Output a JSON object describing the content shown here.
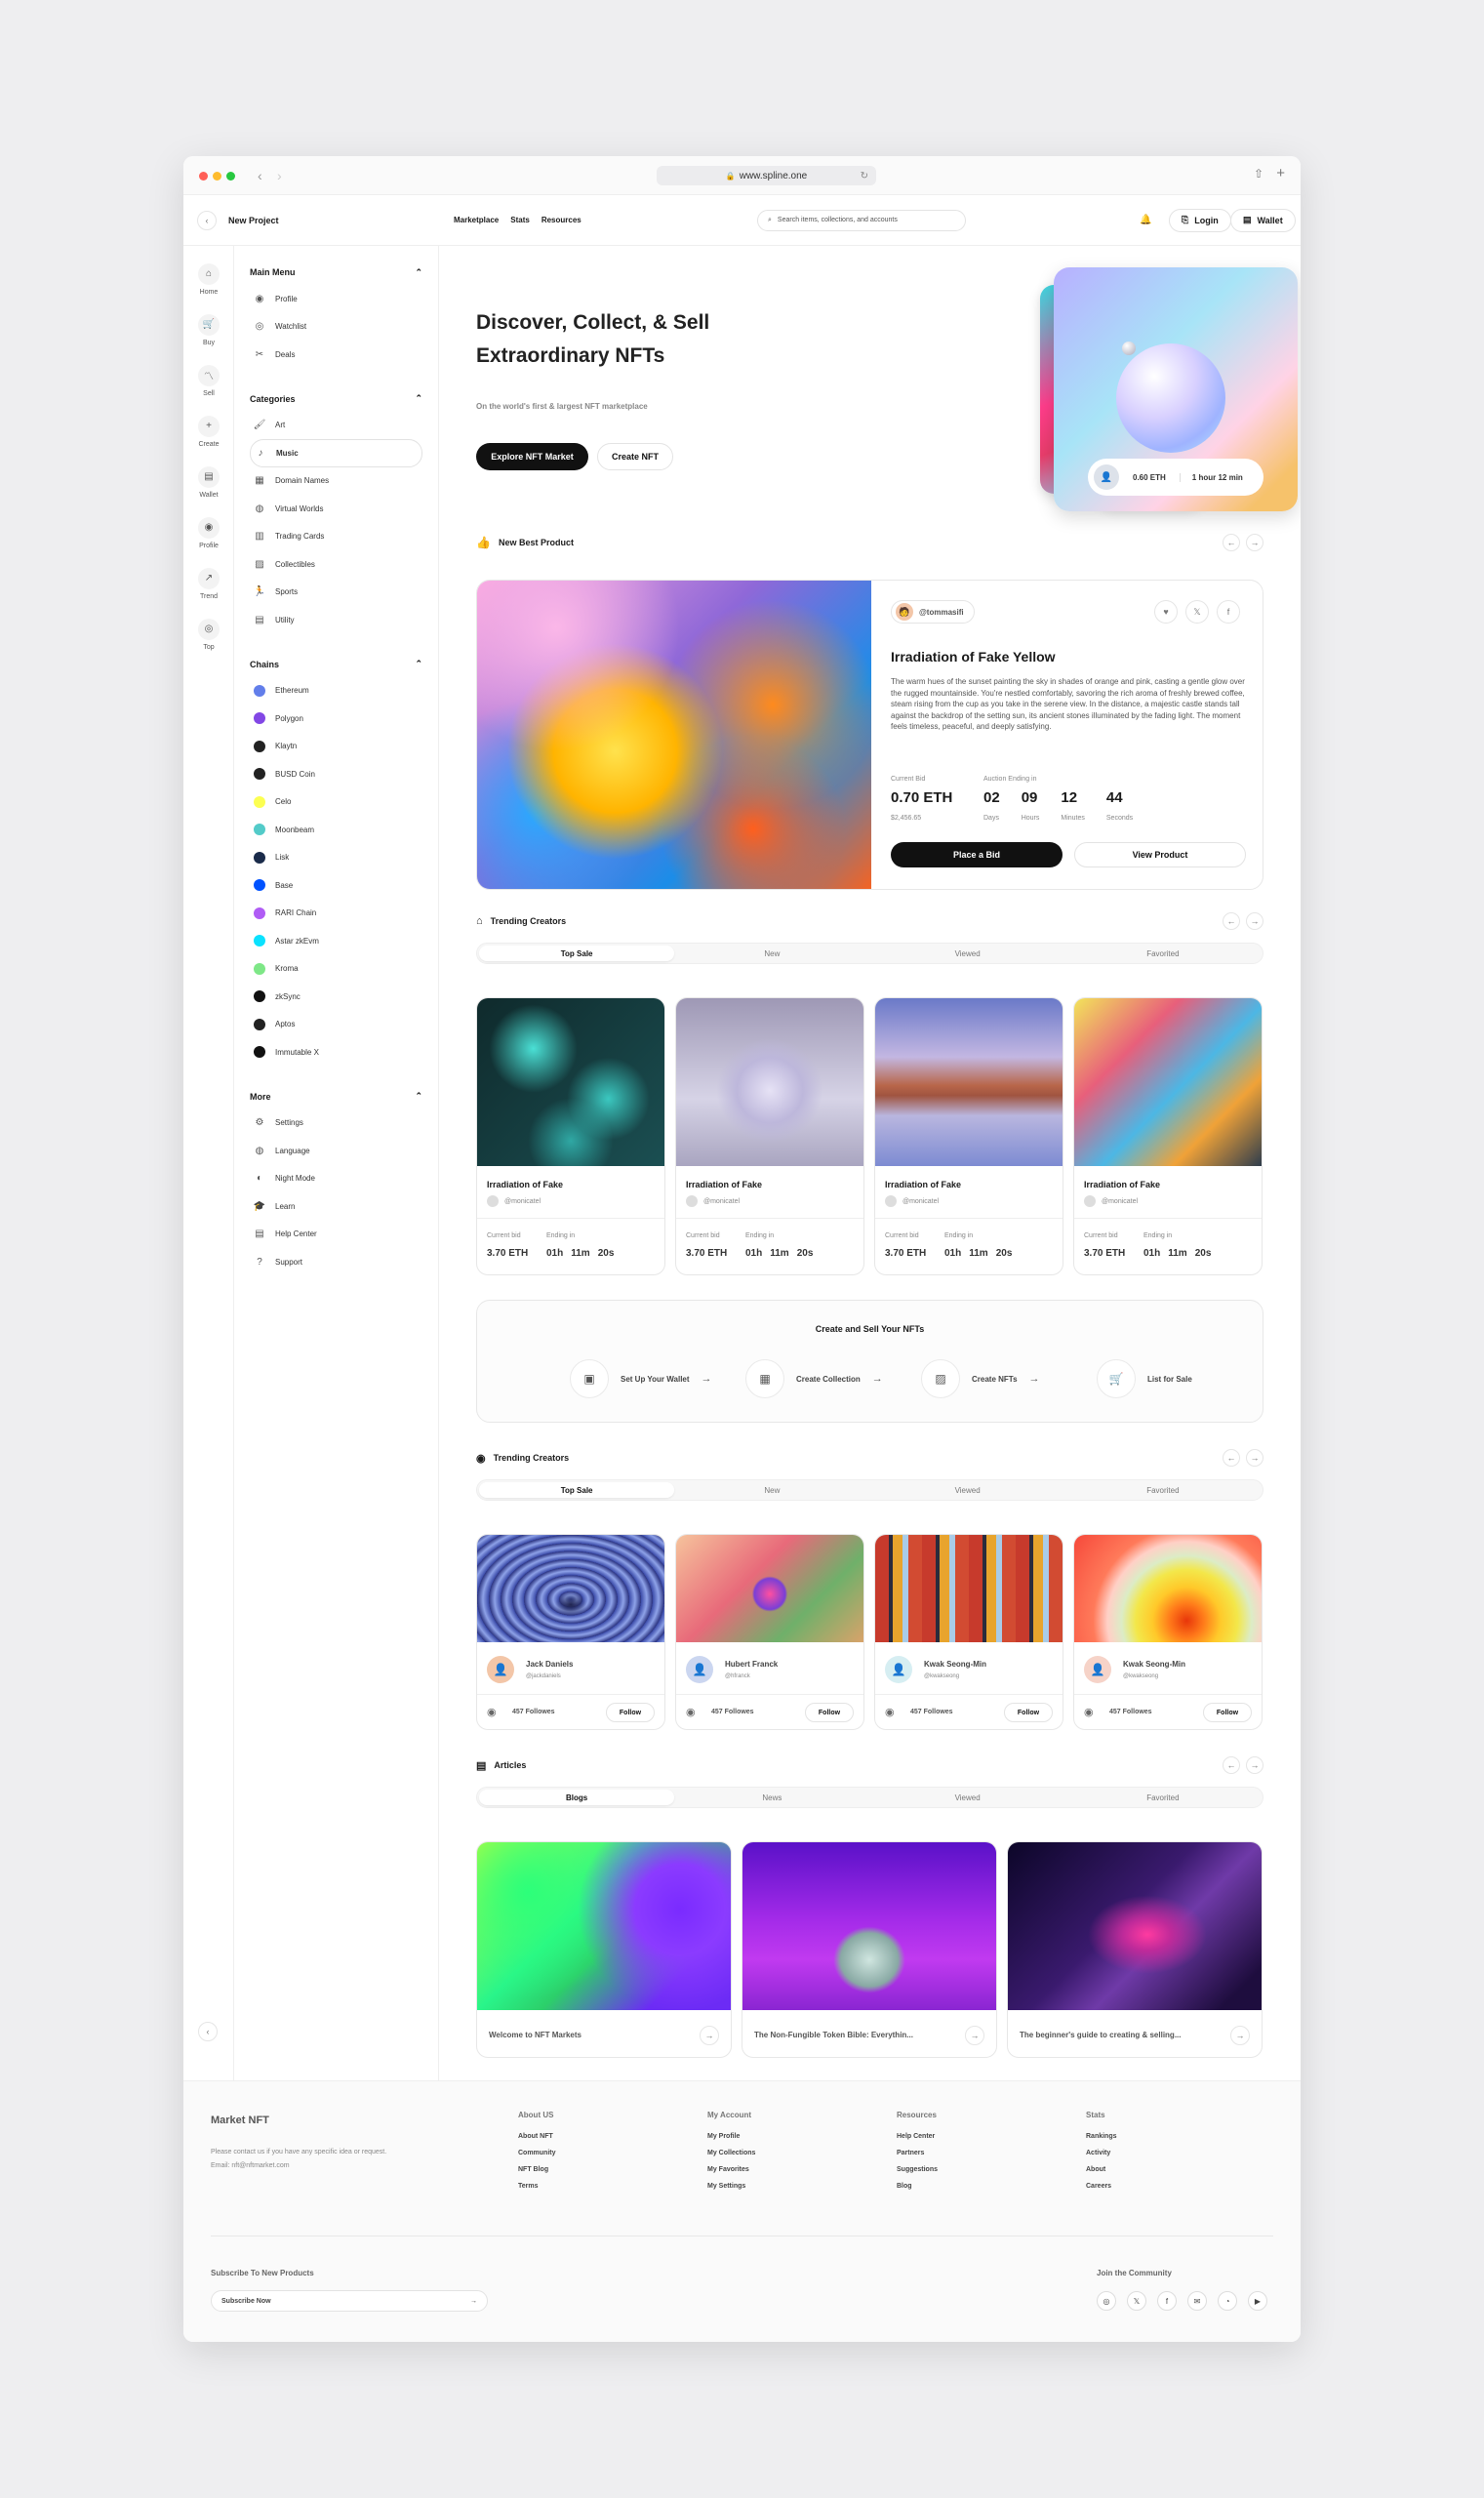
{
  "browser": {
    "url": "www.spline.one"
  },
  "appbar": {
    "project": "New Project",
    "nav": [
      "Marketplace",
      "Stats",
      "Resources"
    ],
    "search_placeholder": "Search items, collections, and accounts",
    "login": "Login",
    "wallet": "Wallet"
  },
  "rail": [
    {
      "label": "Home",
      "icon": "home-icon"
    },
    {
      "label": "Buy",
      "icon": "cart-icon"
    },
    {
      "label": "Sell",
      "icon": "chart-icon"
    },
    {
      "label": "Create",
      "icon": "plus-icon"
    },
    {
      "label": "Wallet",
      "icon": "wallet-icon"
    },
    {
      "label": "Profile",
      "icon": "user-icon"
    },
    {
      "label": "Trend",
      "icon": "trend-icon"
    },
    {
      "label": "Top",
      "icon": "top-icon"
    }
  ],
  "sidebar": {
    "main_menu": {
      "title": "Main Menu",
      "items": [
        "Profile",
        "Watchlist",
        "Deals"
      ]
    },
    "categories": {
      "title": "Categories",
      "items": [
        "Art",
        "Music",
        "Domain Names",
        "Virtual Worlds",
        "Trading Cards",
        "Collectibles",
        "Sports",
        "Utility"
      ],
      "active": "Music"
    },
    "chains": {
      "title": "Chains",
      "items": [
        {
          "name": "Ethereum",
          "color": "#627eea"
        },
        {
          "name": "Polygon",
          "color": "#8247e5"
        },
        {
          "name": "Klaytn",
          "color": "#222222"
        },
        {
          "name": "BUSD Coin",
          "color": "#222222"
        },
        {
          "name": "Celo",
          "color": "#fcff52"
        },
        {
          "name": "Moonbeam",
          "color": "#53cbc9"
        },
        {
          "name": "Lisk",
          "color": "#1a2b4a"
        },
        {
          "name": "Base",
          "color": "#0052ff"
        },
        {
          "name": "RARI Chain",
          "color": "#b05cf5"
        },
        {
          "name": "Astar zkEvm",
          "color": "#0ae2ff"
        },
        {
          "name": "Kroma",
          "color": "#7ee787"
        },
        {
          "name": "zkSync",
          "color": "#111111"
        },
        {
          "name": "Aptos",
          "color": "#222222"
        },
        {
          "name": "Immutable X",
          "color": "#111111"
        }
      ]
    },
    "more": {
      "title": "More",
      "items": [
        "Settings",
        "Language",
        "Night Mode",
        "Learn",
        "Help Center",
        "Support"
      ]
    }
  },
  "hero": {
    "title_line1": "Discover, Collect, & Sell",
    "title_line2": "Extraordinary NFTs",
    "subtitle": "On the world's first & largest NFT marketplace",
    "explore": "Explore NFT Market",
    "create": "Create NFT",
    "badge_price": "0.60 ETH",
    "badge_time": "1 hour 12 min"
  },
  "best": {
    "section": "New Best Product",
    "user": "@tommasifi",
    "title": "Irradiation of Fake Yellow",
    "desc": "The warm hues of the sunset painting the sky in shades of orange and pink, casting a gentle glow over the rugged mountainside. You're nestled comfortably, savoring the rich aroma of freshly brewed coffee, steam rising from the cup as you take in the serene view. In the distance, a majestic castle stands tall against the backdrop of the setting sun, its ancient stones illuminated by the fading light. The moment feels timeless, peaceful, and deeply satisfying.",
    "bid_label": "Current Bid",
    "bid": "0.70 ETH",
    "usd": "$2,456.65",
    "auction_label": "Auction Ending in",
    "countdown": [
      {
        "v": "02",
        "l": "Days"
      },
      {
        "v": "09",
        "l": "Hours"
      },
      {
        "v": "12",
        "l": "Minutes"
      },
      {
        "v": "44",
        "l": "Seconds"
      }
    ],
    "place_bid": "Place a Bid",
    "view_product": "View Product"
  },
  "trending1": {
    "title": "Trending Creators",
    "tabs": [
      "Top Sale",
      "New",
      "Viewed",
      "Favorited"
    ],
    "cards": [
      {
        "name": "Irradiation of Fake",
        "user": "@monicatel",
        "bid_label": "Current bid",
        "bid": "3.70 ETH",
        "end_label": "Ending in",
        "h": "01h",
        "m": "11m",
        "s": "20s"
      },
      {
        "name": "Irradiation of Fake",
        "user": "@monicatel",
        "bid_label": "Current bid",
        "bid": "3.70 ETH",
        "end_label": "Ending in",
        "h": "01h",
        "m": "11m",
        "s": "20s"
      },
      {
        "name": "Irradiation of Fake",
        "user": "@monicatel",
        "bid_label": "Current bid",
        "bid": "3.70 ETH",
        "end_label": "Ending in",
        "h": "01h",
        "m": "11m",
        "s": "20s"
      },
      {
        "name": "Irradiation of Fake",
        "user": "@monicatel",
        "bid_label": "Current bid",
        "bid": "3.70 ETH",
        "end_label": "Ending in",
        "h": "01h",
        "m": "11m",
        "s": "20s"
      }
    ]
  },
  "steps": {
    "title": "Create and Sell Your NFTs",
    "items": [
      "Set Up Your Wallet",
      "Create Collection",
      "Create NFTs",
      "List for Sale"
    ]
  },
  "trending2": {
    "title": "Trending Creators",
    "tabs": [
      "Top Sale",
      "New",
      "Viewed",
      "Favorited"
    ],
    "cards": [
      {
        "name": "Jack Daniels",
        "handle": "@jackdaniels",
        "followers": "457 Followes",
        "follow": "Follow"
      },
      {
        "name": "Hubert Franck",
        "handle": "@hfranck",
        "followers": "457 Followes",
        "follow": "Follow"
      },
      {
        "name": "Kwak Seong-Min",
        "handle": "@kwakseong",
        "followers": "457 Followes",
        "follow": "Follow"
      },
      {
        "name": "Kwak Seong-Min",
        "handle": "@kwakseong",
        "followers": "457 Followes",
        "follow": "Follow"
      }
    ]
  },
  "articles": {
    "title": "Articles",
    "tabs": [
      "Blogs",
      "News",
      "Viewed",
      "Favorited"
    ],
    "items": [
      "Welcome to NFT Markets",
      "The Non-Fungible Token Bible: Everythin...",
      "The beginner's guide to creating & selling..."
    ]
  },
  "footer": {
    "brand": "Market NFT",
    "contact_line1": "Please contact us if you have any specific idea or request.",
    "contact_line2": "Email: nft@nftmarket.com",
    "cols": [
      {
        "title": "About US",
        "items": [
          "About NFT",
          "Community",
          "NFT Blog",
          "Terms"
        ]
      },
      {
        "title": "My Account",
        "items": [
          "My Profile",
          "My Collections",
          "My Favorites",
          "My Settings"
        ]
      },
      {
        "title": "Resources",
        "items": [
          "Help Center",
          "Partners",
          "Suggestions",
          "Blog"
        ]
      },
      {
        "title": "Stats",
        "items": [
          "Rankings",
          "Activity",
          "About",
          "Careers"
        ]
      }
    ],
    "subscribe_title": "Subscribe To New Products",
    "subscribe_placeholder": "Subscribe Now",
    "join": "Join the Community"
  }
}
